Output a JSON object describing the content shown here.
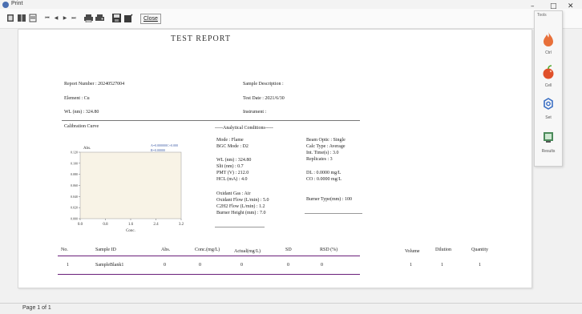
{
  "window": {
    "title": "Print"
  },
  "toolbar": {
    "close_label": "Close"
  },
  "status": {
    "page_indicator": "Page 1 of 1"
  },
  "report": {
    "title": "TEST REPORT",
    "report_number": "Report Number : 20240527004",
    "sample_description": "Sample Description :",
    "element": "Element : Cu",
    "test_date": "Test Date : 2021/6/30",
    "wl": "WL (nm) : 324.80",
    "instrument": "Instrument :",
    "calibration_title": "Calibration Curve",
    "analytical_title": "-----Analytical Conditions-----",
    "conditions_left": [
      "Mode : Flame",
      "BGC Mode : D2",
      "WL (nm) : 324.80",
      "Slit (nm) : 0.7",
      "PMT (V) : 212.0",
      "HCL (mA) : 4.0",
      "Oxidant Gas : Air",
      "Oxidant Flow (L/min) : 5.0",
      "C2H2 Flow (L/min) : 1.2",
      "Burner Height (mm) : 7.0"
    ],
    "conditions_right": [
      "Beam Optic : Single",
      "Calc Type : Average",
      "Int. Time(s) : 3.0",
      "Replicates : 3",
      "DL : 0.0000 mg/L",
      "CO : 0.0000 mg/L",
      "Burner Type(mm) : 100"
    ],
    "table": {
      "headers": [
        "No.",
        "Sample ID",
        "Abs.",
        "Conc.(mg/L)",
        "Actual(mg/L)",
        "SD",
        "RSD (%)",
        "Volume",
        "Dilution",
        "Quantity"
      ],
      "rows": [
        [
          "1",
          "SampleBlank1",
          "0",
          "0",
          "0",
          "0",
          "0",
          "1",
          "1",
          "1"
        ]
      ]
    }
  },
  "chart_data": {
    "type": "line",
    "title": "",
    "xlabel": "Conc.",
    "ylabel": "Abs.",
    "x_ticks": [
      "0.0",
      "0.8",
      "1.6",
      "2.4",
      "3.2"
    ],
    "y_ticks": [
      "0.000",
      "0.020",
      "0.040",
      "0.060",
      "0.080",
      "0.100",
      "0.120"
    ],
    "xlim": [
      0,
      3.2
    ],
    "ylim": [
      0,
      0.12
    ],
    "series": [],
    "equation_lines": [
      "A=0.000000C+0.000",
      "R=0.00000"
    ],
    "grid": false,
    "background": "#f8f3e6"
  },
  "palette": {
    "title": "Tools",
    "items": [
      {
        "label": "Ctrl",
        "icon": "flame-icon"
      },
      {
        "label": "Cell",
        "icon": "apple-icon"
      },
      {
        "label": "Set",
        "icon": "gear-icon"
      },
      {
        "label": "Results",
        "icon": "monitor-icon"
      }
    ]
  },
  "colors": {
    "accent": "#6a1f7a",
    "chart_line": "#3b5aa6",
    "flame": "#e8703a"
  }
}
